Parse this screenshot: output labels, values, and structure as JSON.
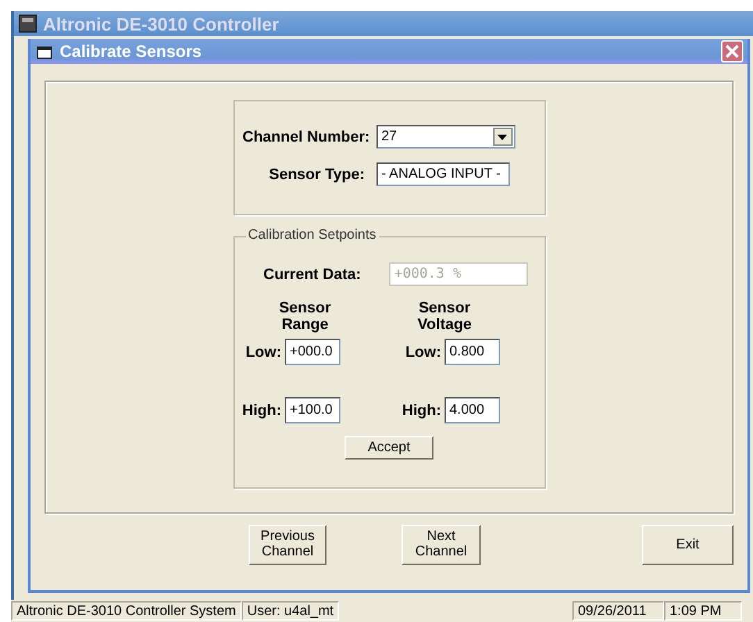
{
  "app_window": {
    "title": "Altronic DE-3010 Controller"
  },
  "dialog": {
    "title": "Calibrate Sensors"
  },
  "channel": {
    "label": "Channel Number:",
    "value": "27"
  },
  "sensor_type": {
    "label": "Sensor Type:",
    "value": "- ANALOG INPUT -"
  },
  "calibration": {
    "title": "Calibration Setpoints",
    "current_data": {
      "label": "Current Data:",
      "value": "+000.3 %",
      "disabled": true
    },
    "columns": [
      {
        "heading": "Sensor Range",
        "low_label": "Low:",
        "low": "+000.0",
        "high_label": "High:",
        "high": "+100.0"
      },
      {
        "heading": "Sensor Voltage",
        "low_label": "Low:",
        "low": "0.800",
        "high_label": "High:",
        "high": "4.000"
      }
    ],
    "accept": "Accept"
  },
  "buttons": [
    "Previous Channel",
    "Next Channel",
    "Exit"
  ],
  "status_bar": {
    "system": "Altronic DE-3010 Controller System",
    "user": "User: u4al_mt",
    "date": "09/26/2011",
    "time": "1:09 PM"
  }
}
